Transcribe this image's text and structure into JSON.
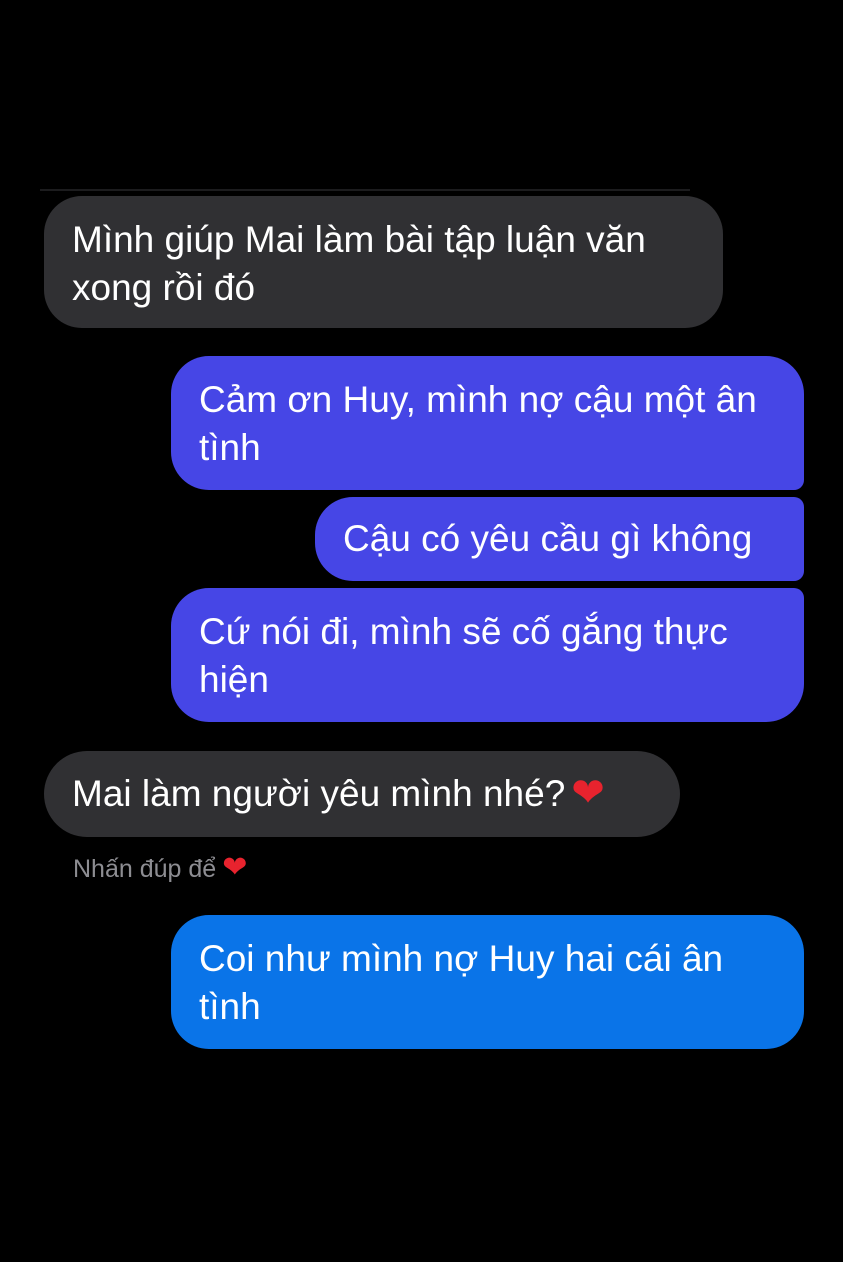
{
  "conversation": {
    "messages": [
      {
        "sender": "other",
        "text": "Mình giúp Mai làm bài tập luận văn xong rồi đó"
      },
      {
        "sender": "me",
        "text": "Cảm ơn Huy, mình nợ cậu một ân tình"
      },
      {
        "sender": "me",
        "text": "Cậu có yêu cầu gì không"
      },
      {
        "sender": "me",
        "text": "Cứ nói đi, mình sẽ cố gắng thực hiện"
      },
      {
        "sender": "other",
        "text": "Mai làm người yêu mình nhé?",
        "emoji": "heart-icon"
      },
      {
        "sender": "me",
        "text": "Coi như mình nợ Huy hai cái ân tình"
      }
    ],
    "double_tap_hint": "Nhấn đúp để"
  },
  "colors": {
    "background": "#000000",
    "incoming_bubble": "#303033",
    "outgoing_bubble": "#4646e6",
    "outgoing_bubble_latest": "#0a74e8",
    "heart": "#e8232e",
    "hint_text": "#8d8d92"
  }
}
